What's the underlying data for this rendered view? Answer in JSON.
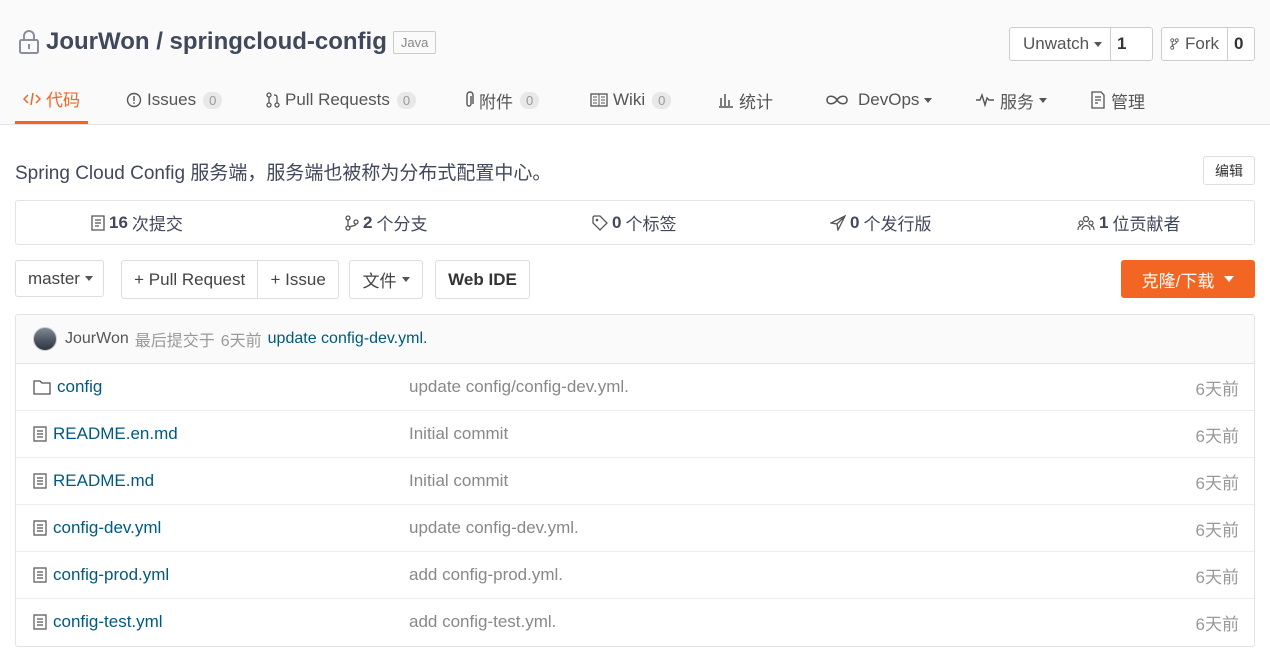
{
  "repo": {
    "owner_and_name": "JourWon / springcloud-config",
    "language": "Java",
    "watch": {
      "label": "Unwatch",
      "count": "1"
    },
    "fork": {
      "label": "Fork",
      "count": "0"
    }
  },
  "tabs": [
    {
      "label": "代码",
      "icon": "code-icon",
      "active": true
    },
    {
      "label": "Issues",
      "badge": "0",
      "icon": "issue-icon"
    },
    {
      "label": "Pull Requests",
      "badge": "0",
      "icon": "pull-request-icon"
    },
    {
      "label": "附件",
      "badge": "0",
      "icon": "paperclip-icon"
    },
    {
      "label": "Wiki",
      "badge": "0",
      "icon": "book-icon"
    },
    {
      "label": "统计",
      "icon": "bar-chart-icon"
    },
    {
      "label": "DevOps",
      "icon": "infinity-icon"
    },
    {
      "label": "服务",
      "icon": "pulse-icon"
    },
    {
      "label": "管理",
      "icon": "settings-doc-icon"
    }
  ],
  "description": "Spring Cloud Config 服务端，服务端也被称为分布式配置中心。",
  "edit_label": "编辑",
  "stats": [
    {
      "num": "16",
      "label": "次提交",
      "icon": "commit-icon"
    },
    {
      "num": "2",
      "label": "个分支",
      "icon": "branch-icon"
    },
    {
      "num": "0",
      "label": "个标签",
      "icon": "tag-icon"
    },
    {
      "num": "0",
      "label": "个发行版",
      "icon": "release-icon"
    },
    {
      "num": "1",
      "label": "位贡献者",
      "icon": "contributors-icon"
    }
  ],
  "toolbar": {
    "branch": "master",
    "pull_request": "+ Pull Request",
    "issue": "+ Issue",
    "files": "文件",
    "web_ide": "Web IDE",
    "clone": "克隆/下载"
  },
  "last_commit": {
    "user": "JourWon",
    "action": "最后提交于",
    "time": "6天前",
    "message": "update config-dev.yml."
  },
  "files": [
    {
      "name": "config",
      "type": "folder",
      "commit": "update config/config-dev.yml.",
      "time": "6天前"
    },
    {
      "name": "README.en.md",
      "type": "file",
      "commit": "Initial commit",
      "time": "6天前"
    },
    {
      "name": "README.md",
      "type": "file",
      "commit": "Initial commit",
      "time": "6天前"
    },
    {
      "name": "config-dev.yml",
      "type": "file",
      "commit": "update config-dev.yml.",
      "time": "6天前"
    },
    {
      "name": "config-prod.yml",
      "type": "file",
      "commit": "add config-prod.yml.",
      "time": "6天前"
    },
    {
      "name": "config-test.yml",
      "type": "file",
      "commit": "add config-test.yml.",
      "time": "6天前"
    }
  ],
  "colors": {
    "accent": "#f26522",
    "link": "#005980"
  }
}
